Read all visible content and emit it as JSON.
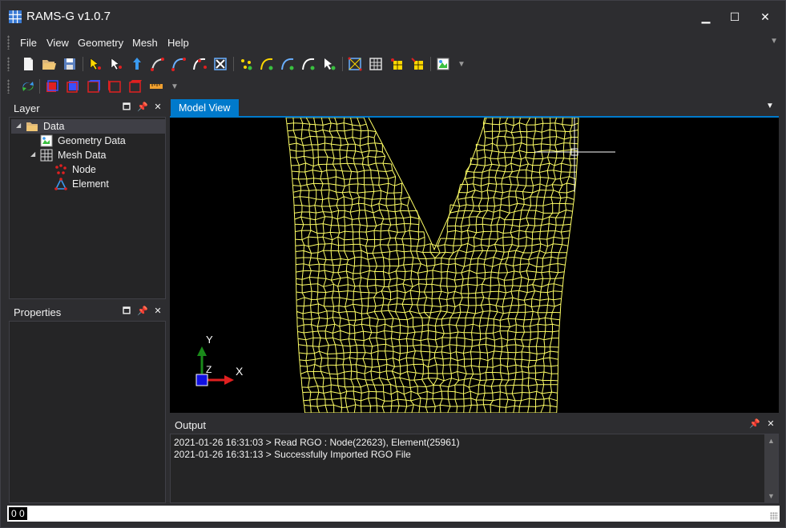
{
  "app": {
    "title": "RAMS-G v1.0.7"
  },
  "window_controls": {
    "minimize": "▁",
    "maximize": "☐",
    "close": "✕"
  },
  "menu": {
    "items": [
      "File",
      "View",
      "Geometry",
      "Mesh",
      "Help"
    ]
  },
  "toolbar1": {
    "buttons": [
      "new-file-icon",
      "open-folder-icon",
      "save-icon",
      "select-node-icon",
      "select-element-icon",
      "move-node-icon",
      "drag-node-icon",
      "curve-edit-icon",
      "curve-split-icon",
      "delete-mesh-icon",
      "add-node-icon",
      "add-curve-icon",
      "curve-node-icon",
      "curve-merge-icon",
      "refine-icon",
      "grid-quad-icon",
      "grid-edit-icon",
      "grid-point-icon",
      "grid-export-icon",
      "map-icon"
    ]
  },
  "toolbar2": {
    "buttons": [
      "refresh-icon",
      "view-front-icon",
      "view-back-icon",
      "view-left-icon",
      "view-right-icon",
      "view-top-icon",
      "ruler-icon"
    ]
  },
  "layer_panel": {
    "title": "Layer",
    "tree": [
      {
        "label": "Data",
        "level": 0,
        "expanded": true,
        "icon": "folder-icon",
        "selected": true
      },
      {
        "label": "Geometry Data",
        "level": 1,
        "icon": "geometry-icon"
      },
      {
        "label": "Mesh Data",
        "level": 1,
        "expanded": true,
        "icon": "mesh-icon"
      },
      {
        "label": "Node",
        "level": 2,
        "icon": "node-icon"
      },
      {
        "label": "Element",
        "level": 2,
        "icon": "element-icon"
      }
    ]
  },
  "properties_panel": {
    "title": "Properties"
  },
  "document_tab": {
    "label": "Model View"
  },
  "viewport": {
    "background": "#000000",
    "mesh_color": "#ffff66",
    "axis": {
      "y_label": "Y",
      "z_label": "Z",
      "x_label": "X",
      "x_color": "#e02020",
      "y_color": "#1a8a1a",
      "z_color": "#1010e0"
    }
  },
  "output_panel": {
    "title": "Output",
    "lines": [
      "2021-01-26 16:31:03 > Read RGO : Node(22623), Element(25961)",
      "2021-01-26 16:31:13 > Successfully Imported RGO File"
    ]
  },
  "status": {
    "coords": "0 0"
  }
}
